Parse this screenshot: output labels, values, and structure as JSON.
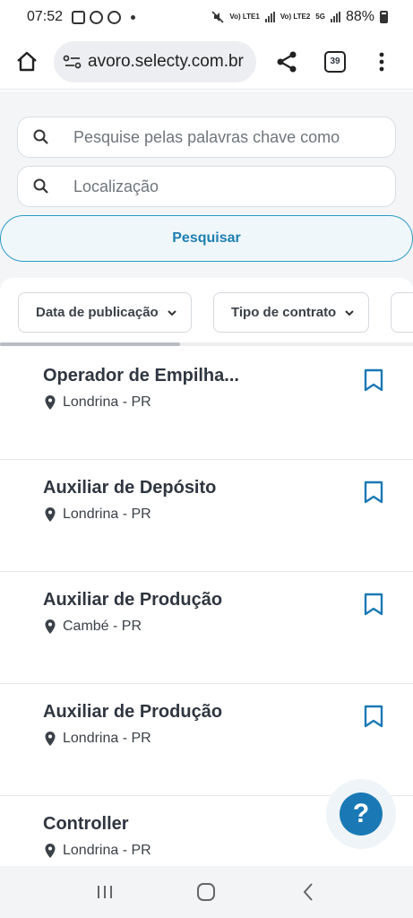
{
  "status_bar": {
    "time": "07:52",
    "network_left": "Vo) LTE1",
    "network_right": "Vo) LTE2",
    "network_5g": "5G",
    "battery": "88%"
  },
  "browser": {
    "url": "avoro.selecty.com.br",
    "tab_count": "39"
  },
  "search": {
    "keywords_placeholder": "Pesquise pelas palavras chave como",
    "location_placeholder": "Localização",
    "button_label": "Pesquisar"
  },
  "filters": [
    {
      "label": "Data de publicação"
    },
    {
      "label": "Tipo de contrato"
    }
  ],
  "jobs": [
    {
      "title": "Operador de Empilha...",
      "location": "Londrina - PR"
    },
    {
      "title": "Auxiliar de Depósito",
      "location": "Londrina - PR"
    },
    {
      "title": "Auxiliar de Produção",
      "location": "Cambé - PR"
    },
    {
      "title": "Auxiliar de Produção",
      "location": "Londrina - PR"
    },
    {
      "title": "Controller",
      "location": "Londrina - PR"
    }
  ],
  "help_button": "?",
  "colors": {
    "accent": "#1a79b5",
    "search_border": "#2b9bc8",
    "text": "#2f3640"
  }
}
